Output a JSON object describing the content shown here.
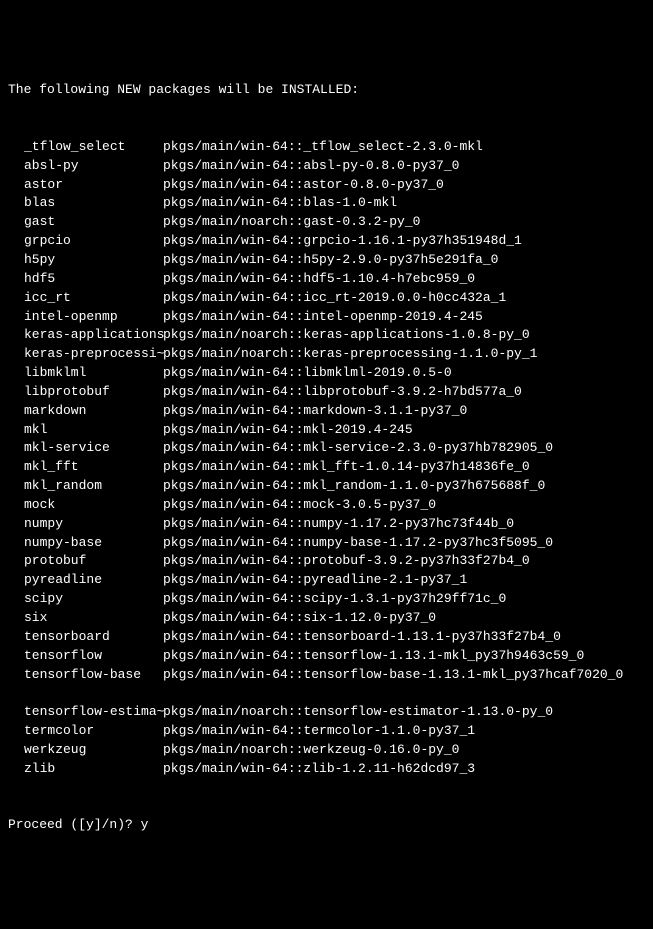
{
  "header": "The following NEW packages will be INSTALLED:",
  "packages": [
    {
      "name": "_tflow_select",
      "spec": "pkgs/main/win-64::_tflow_select-2.3.0-mkl"
    },
    {
      "name": "absl-py",
      "spec": "pkgs/main/win-64::absl-py-0.8.0-py37_0"
    },
    {
      "name": "astor",
      "spec": "pkgs/main/win-64::astor-0.8.0-py37_0"
    },
    {
      "name": "blas",
      "spec": "pkgs/main/win-64::blas-1.0-mkl"
    },
    {
      "name": "gast",
      "spec": "pkgs/main/noarch::gast-0.3.2-py_0"
    },
    {
      "name": "grpcio",
      "spec": "pkgs/main/win-64::grpcio-1.16.1-py37h351948d_1"
    },
    {
      "name": "h5py",
      "spec": "pkgs/main/win-64::h5py-2.9.0-py37h5e291fa_0"
    },
    {
      "name": "hdf5",
      "spec": "pkgs/main/win-64::hdf5-1.10.4-h7ebc959_0"
    },
    {
      "name": "icc_rt",
      "spec": "pkgs/main/win-64::icc_rt-2019.0.0-h0cc432a_1"
    },
    {
      "name": "intel-openmp",
      "spec": "pkgs/main/win-64::intel-openmp-2019.4-245"
    },
    {
      "name": "keras-applications",
      "spec": "pkgs/main/noarch::keras-applications-1.0.8-py_0"
    },
    {
      "name": "keras-preprocessi~",
      "spec": "pkgs/main/noarch::keras-preprocessing-1.1.0-py_1"
    },
    {
      "name": "libmklml",
      "spec": "pkgs/main/win-64::libmklml-2019.0.5-0"
    },
    {
      "name": "libprotobuf",
      "spec": "pkgs/main/win-64::libprotobuf-3.9.2-h7bd577a_0"
    },
    {
      "name": "markdown",
      "spec": "pkgs/main/win-64::markdown-3.1.1-py37_0"
    },
    {
      "name": "mkl",
      "spec": "pkgs/main/win-64::mkl-2019.4-245"
    },
    {
      "name": "mkl-service",
      "spec": "pkgs/main/win-64::mkl-service-2.3.0-py37hb782905_0"
    },
    {
      "name": "mkl_fft",
      "spec": "pkgs/main/win-64::mkl_fft-1.0.14-py37h14836fe_0"
    },
    {
      "name": "mkl_random",
      "spec": "pkgs/main/win-64::mkl_random-1.1.0-py37h675688f_0"
    },
    {
      "name": "mock",
      "spec": "pkgs/main/win-64::mock-3.0.5-py37_0"
    },
    {
      "name": "numpy",
      "spec": "pkgs/main/win-64::numpy-1.17.2-py37hc73f44b_0"
    },
    {
      "name": "numpy-base",
      "spec": "pkgs/main/win-64::numpy-base-1.17.2-py37hc3f5095_0"
    },
    {
      "name": "protobuf",
      "spec": "pkgs/main/win-64::protobuf-3.9.2-py37h33f27b4_0"
    },
    {
      "name": "pyreadline",
      "spec": "pkgs/main/win-64::pyreadline-2.1-py37_1"
    },
    {
      "name": "scipy",
      "spec": "pkgs/main/win-64::scipy-1.3.1-py37h29ff71c_0"
    },
    {
      "name": "six",
      "spec": "pkgs/main/win-64::six-1.12.0-py37_0"
    },
    {
      "name": "tensorboard",
      "spec": "pkgs/main/win-64::tensorboard-1.13.1-py37h33f27b4_0"
    },
    {
      "name": "tensorflow",
      "spec": "pkgs/main/win-64::tensorflow-1.13.1-mkl_py37h9463c59_0"
    },
    {
      "name": "tensorflow-base",
      "spec": "pkgs/main/win-64::tensorflow-base-1.13.1-mkl_py37hcaf7020_0"
    },
    {
      "name": "",
      "spec": ""
    },
    {
      "name": "tensorflow-estima~",
      "spec": "pkgs/main/noarch::tensorflow-estimator-1.13.0-py_0"
    },
    {
      "name": "termcolor",
      "spec": "pkgs/main/win-64::termcolor-1.1.0-py37_1"
    },
    {
      "name": "werkzeug",
      "spec": "pkgs/main/noarch::werkzeug-0.16.0-py_0"
    },
    {
      "name": "zlib",
      "spec": "pkgs/main/win-64::zlib-1.2.11-h62dcd97_3"
    }
  ],
  "prompt": "Proceed ([y]/n)? ",
  "input_value": "y"
}
